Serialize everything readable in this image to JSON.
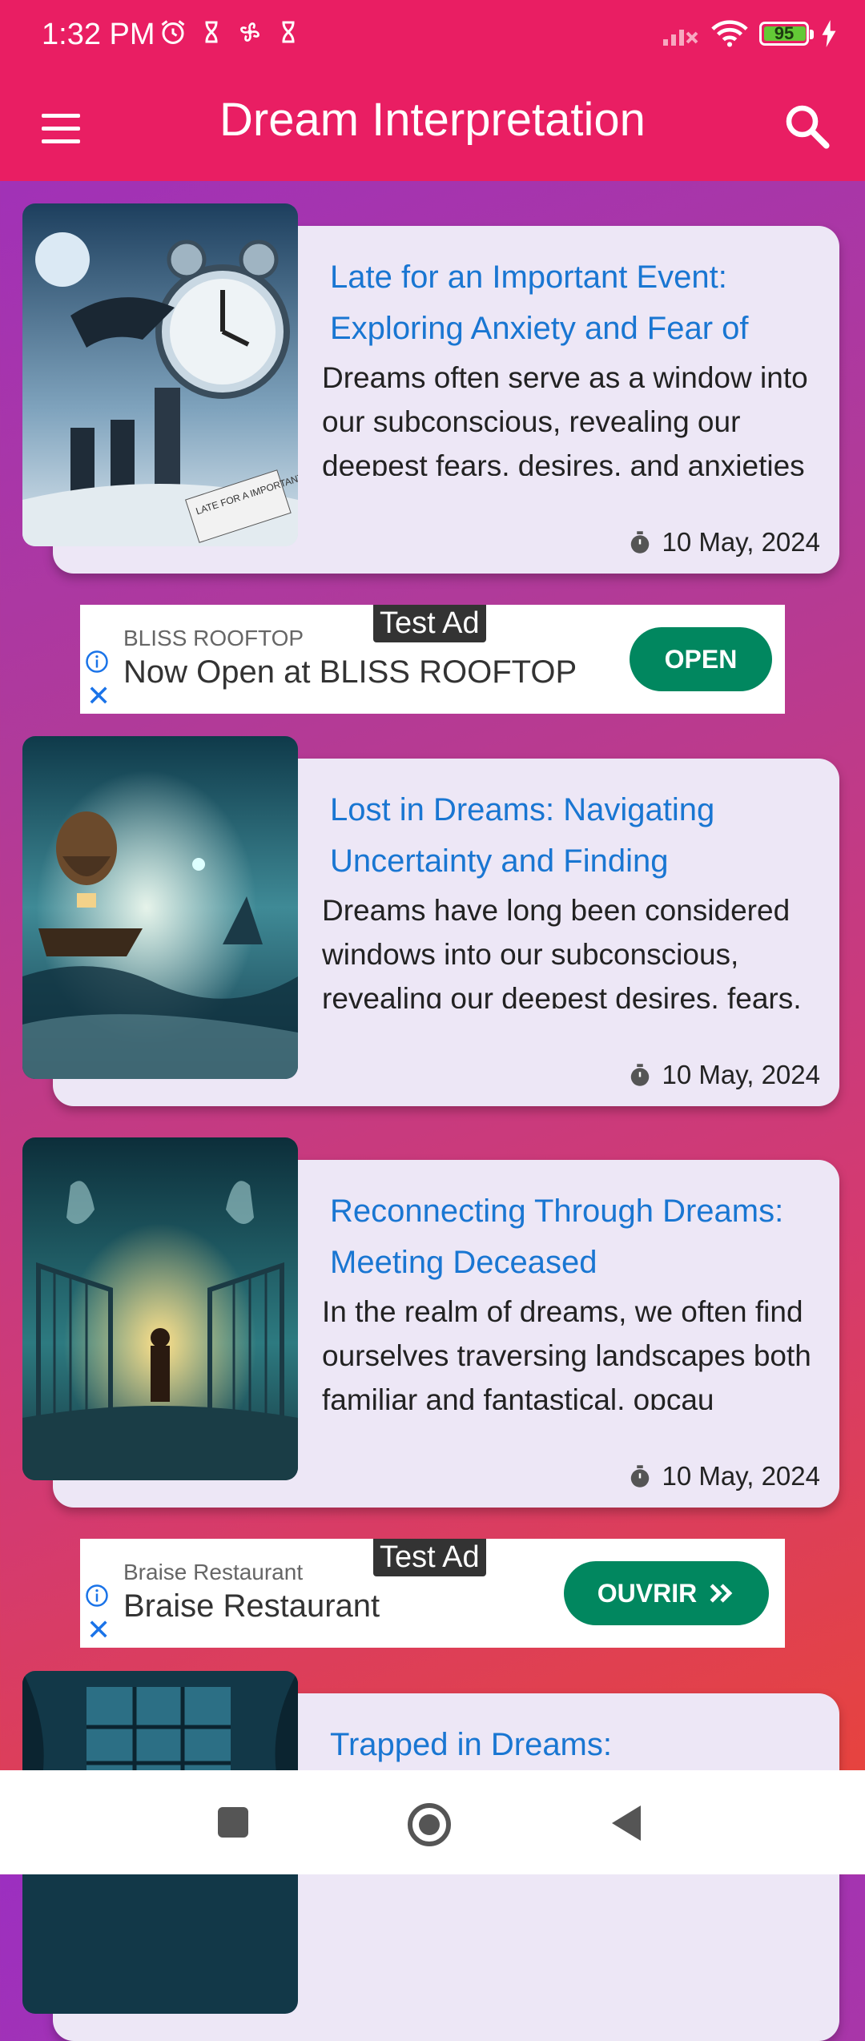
{
  "status_bar": {
    "time": "1:32 PM",
    "battery": "95"
  },
  "app_bar": {
    "title": "Dream Interpretation"
  },
  "cards": [
    {
      "title": "Late for an Important Event: Exploring Anxiety and Fear of",
      "description": "Dreams often serve as a window into our subconscious, revealing our deepest fears, desires, and anxieties",
      "date": "10 May, 2024",
      "image_text": "LATE FOR A IMPORTANT EVENT"
    },
    {
      "title": "Lost in Dreams: Navigating Uncertainty and Finding",
      "description": "Dreams have long been considered windows into our subconscious, revealing our deepest desires, fears, and",
      "date": "10 May, 2024"
    },
    {
      "title": "Reconnecting Through Dreams: Meeting Deceased",
      "description": "In the realm of dreams, we often find ourselves traversing landscapes both familiar and fantastical, opcau",
      "date": "10 May, 2024"
    },
    {
      "title": "Trapped in Dreams:"
    }
  ],
  "ads": [
    {
      "tag": "Test Ad",
      "advertiser": "BLISS ROOFTOP",
      "headline": "Now Open at BLISS ROOFTOP",
      "button": "OPEN"
    },
    {
      "tag": "Test Ad",
      "advertiser": "Braise Restaurant",
      "headline": "Braise Restaurant",
      "button": "OUVRIR"
    }
  ],
  "colors": {
    "primary": "#e91e63",
    "title_blue": "#1976d2",
    "card_bg": "#ede7f6",
    "ad_button": "#01875f"
  }
}
